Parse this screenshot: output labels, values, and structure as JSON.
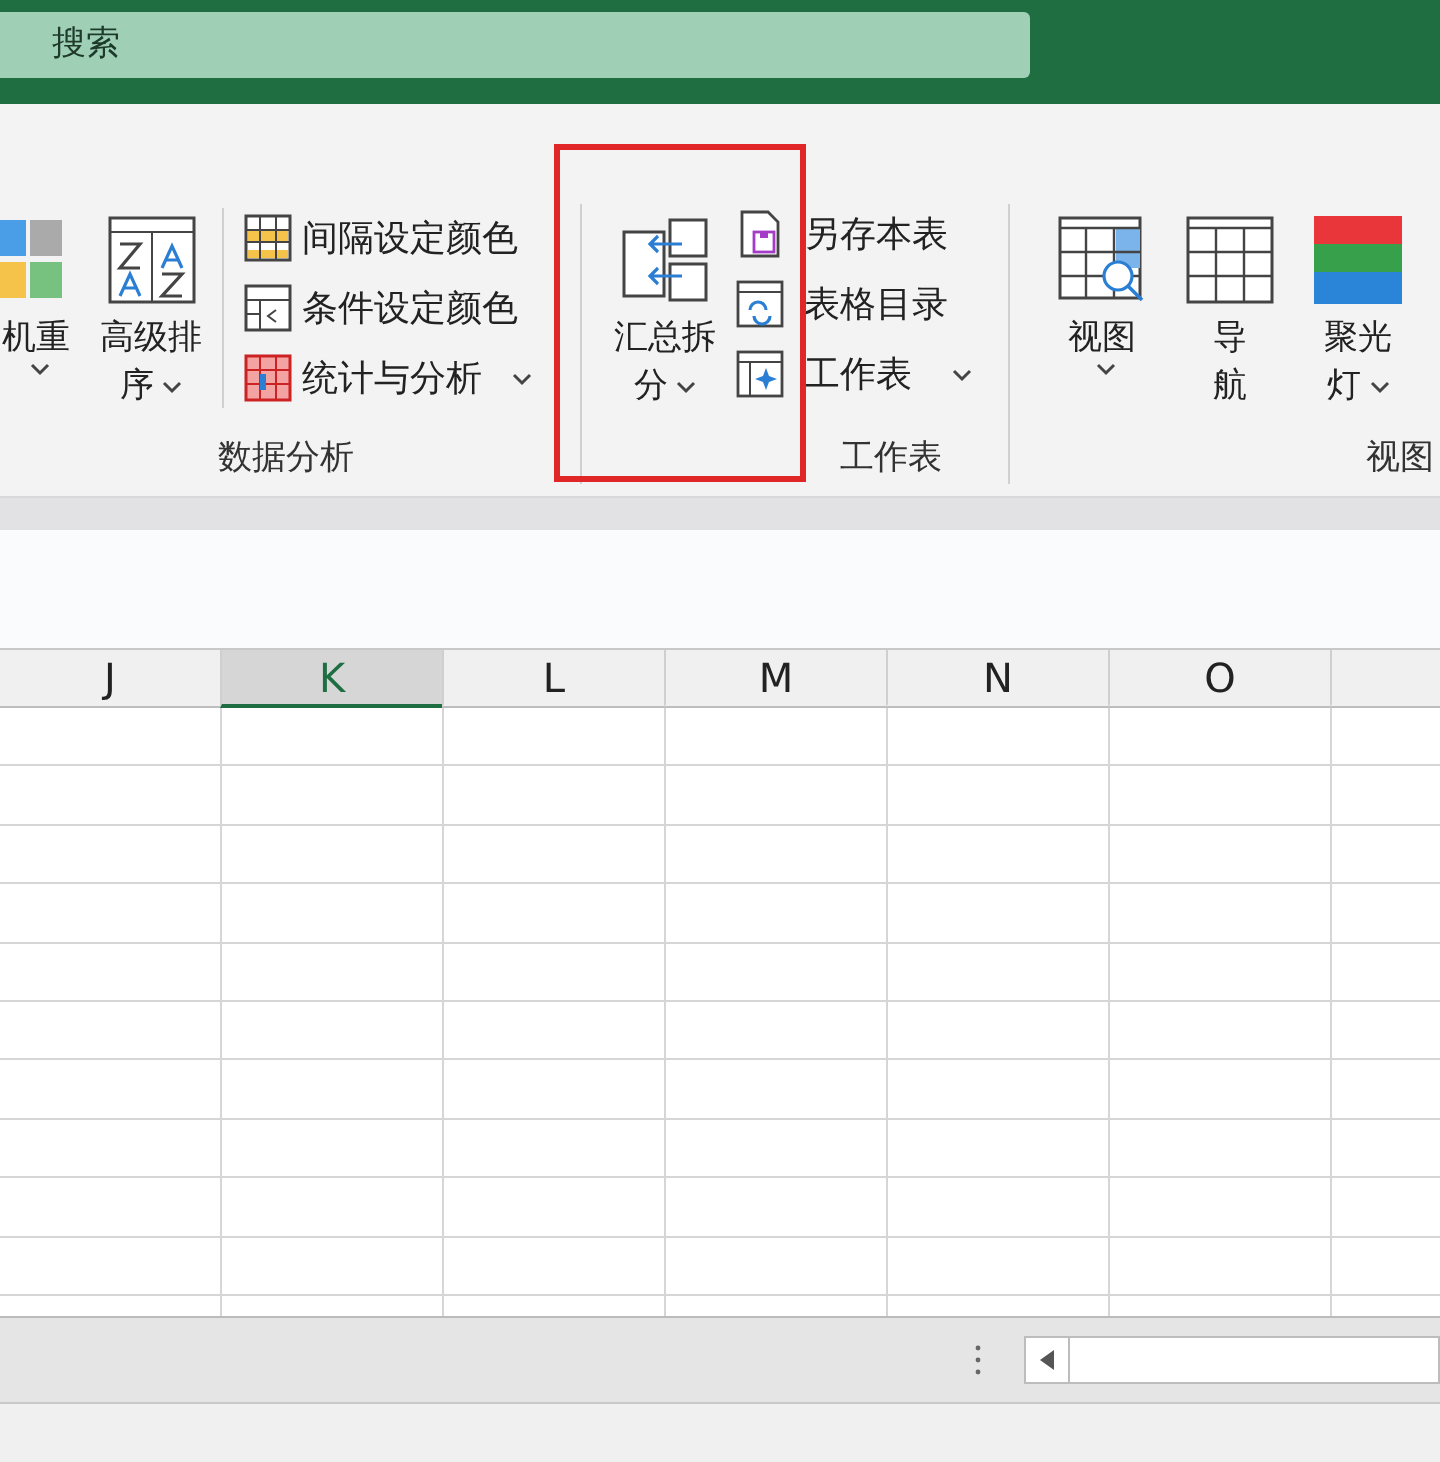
{
  "title_bar": {
    "search": {
      "placeholder": "搜索"
    }
  },
  "ribbon": {
    "groups": [
      {
        "label": "数据分析",
        "items": [
          {
            "kind": "large",
            "lines": [
              "机重"
            ],
            "dropdown": true
          },
          {
            "kind": "large",
            "lines": [
              "高级排",
              "序"
            ],
            "dropdown": true
          },
          {
            "kind": "stack",
            "buttons": [
              {
                "label": "间隔设定颜色",
                "dropdown": false
              },
              {
                "label": "条件设定颜色",
                "dropdown": false
              },
              {
                "label": "统计与分析",
                "dropdown": true
              }
            ]
          }
        ]
      },
      {
        "label": "工作表",
        "items": [
          {
            "kind": "large",
            "lines": [
              "汇总拆",
              "分"
            ],
            "dropdown": true
          },
          {
            "kind": "stack",
            "buttons": [
              {
                "label": "另存本表",
                "dropdown": false
              },
              {
                "label": "表格目录",
                "dropdown": false
              },
              {
                "label": "工作表",
                "dropdown": true
              }
            ]
          }
        ]
      },
      {
        "label": "视图",
        "items": [
          {
            "kind": "large",
            "lines": [
              "视图"
            ],
            "dropdown": true
          },
          {
            "kind": "large",
            "lines": [
              "导",
              "航"
            ],
            "dropdown": false
          },
          {
            "kind": "large",
            "lines": [
              "聚光",
              "灯"
            ],
            "dropdown": true
          }
        ]
      }
    ]
  },
  "sheet": {
    "columns": [
      {
        "label": "J",
        "selected": false
      },
      {
        "label": "K",
        "selected": true
      },
      {
        "label": "L",
        "selected": false
      },
      {
        "label": "M",
        "selected": false
      },
      {
        "label": "N",
        "selected": false
      },
      {
        "label": "O",
        "selected": false
      }
    ]
  }
}
